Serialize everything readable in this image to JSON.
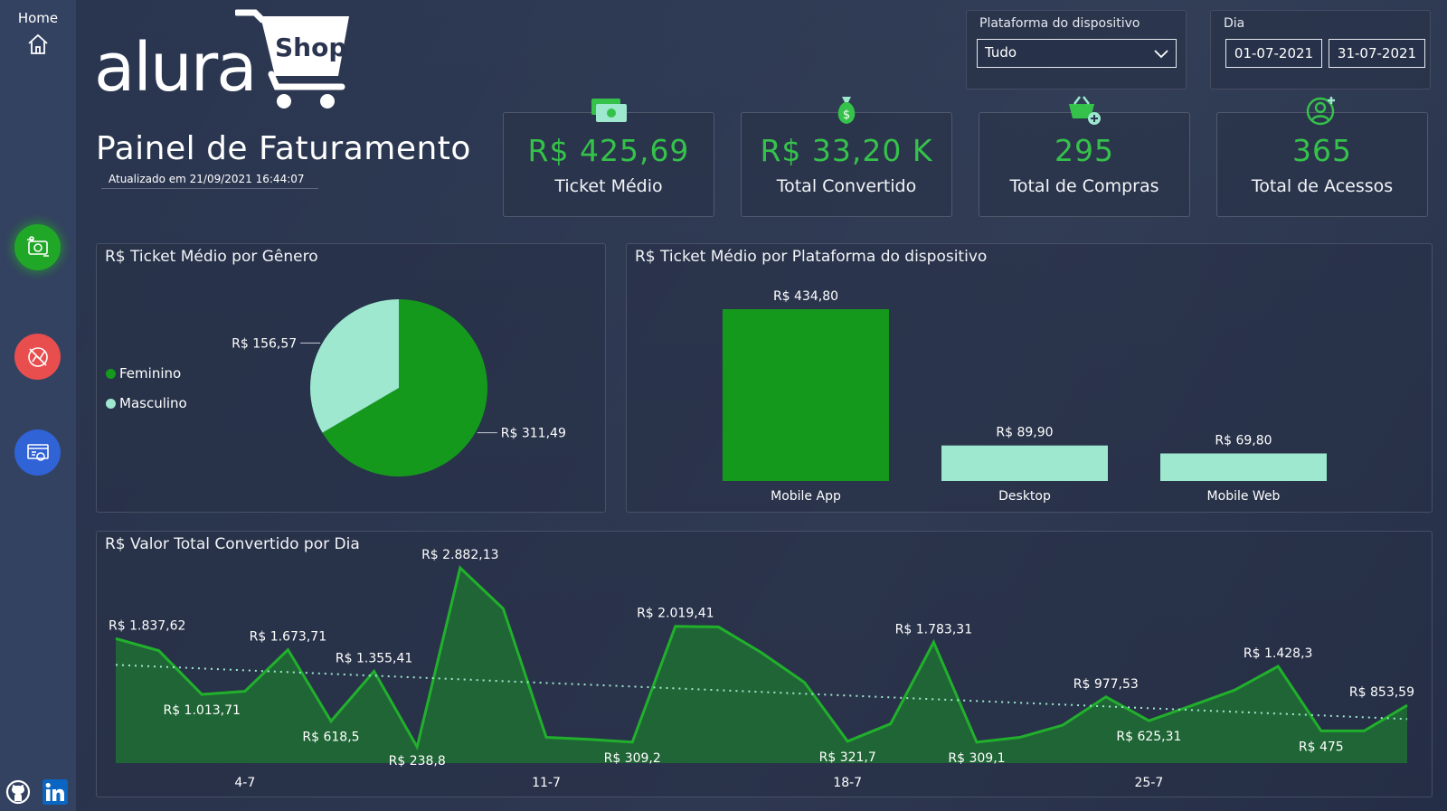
{
  "sidebar": {
    "home_label": "Home"
  },
  "header": {
    "logo_text": "alura",
    "logo_badge": "Shop",
    "title": "Painel de Faturamento",
    "updated": "Atualizado em 21/09/2021 16:44:07"
  },
  "filters": {
    "platform": {
      "label": "Plataforma do dispositivo",
      "value": "Tudo"
    },
    "day": {
      "label": "Dia",
      "start": "01-07-2021",
      "end": "31-07-2021"
    }
  },
  "kpis": [
    {
      "value": "R$ 425,69",
      "label": "Ticket Médio",
      "icon": "money-bills-icon"
    },
    {
      "value": "R$ 33,20 K",
      "label": "Total Convertido",
      "icon": "money-bag-icon"
    },
    {
      "value": "295",
      "label": "Total de Compras",
      "icon": "basket-add-icon"
    },
    {
      "value": "365",
      "label": "Total de Acessos",
      "icon": "user-add-icon"
    }
  ],
  "colors": {
    "accent_green": "#35c24a",
    "dark_green": "#15991d",
    "mint": "#9de8cf",
    "background": "#27324a"
  },
  "chart_data": [
    {
      "type": "pie",
      "title": "R$ Ticket Médio por Gênero",
      "legend": [
        "Feminino",
        "Masculino"
      ],
      "legend_position": "left",
      "series": [
        {
          "name": "Feminino",
          "value": 311.49,
          "label": "R$ 311,49",
          "color": "#15991d"
        },
        {
          "name": "Masculino",
          "value": 156.57,
          "label": "R$ 156,57",
          "color": "#9de8cf"
        }
      ]
    },
    {
      "type": "bar",
      "title": "R$ Ticket Médio por Plataforma do dispositivo",
      "categories": [
        "Mobile App",
        "Desktop",
        "Mobile Web"
      ],
      "values": [
        434.8,
        89.9,
        69.8
      ],
      "labels": [
        "R$ 434,80",
        "R$ 89,90",
        "R$ 69,80"
      ],
      "colors": [
        "#15991d",
        "#9de8cf",
        "#9de8cf"
      ],
      "ylim": [
        0,
        434.8
      ]
    },
    {
      "type": "area",
      "title": "R$ Valor Total Convertido por Dia",
      "x_ticks": [
        "4-7",
        "11-7",
        "18-7",
        "25-7"
      ],
      "x": [
        1,
        2,
        3,
        4,
        5,
        6,
        7,
        8,
        9,
        10,
        11,
        12,
        13,
        14,
        15,
        16,
        17,
        18,
        19,
        20,
        21,
        22,
        23,
        24,
        25,
        26,
        27,
        28,
        29,
        30,
        31
      ],
      "values": [
        1837.62,
        1660,
        1013.71,
        1060,
        1673.71,
        618.5,
        1355.41,
        238.8,
        2882.13,
        2280,
        380,
        350,
        309.2,
        2019.41,
        2010,
        1630,
        1190,
        321.7,
        580,
        1783.31,
        309.1,
        380,
        560,
        977.53,
        625.31,
        850,
        1080,
        1428.3,
        475,
        475,
        853.59
      ],
      "point_labels": [
        {
          "index": 0,
          "text": "R$ 1.837,62"
        },
        {
          "index": 2,
          "text": "R$ 1.013,71"
        },
        {
          "index": 4,
          "text": "R$ 1.673,71"
        },
        {
          "index": 5,
          "text": "R$ 618,5"
        },
        {
          "index": 6,
          "text": "R$ 1.355,41"
        },
        {
          "index": 7,
          "text": "R$ 238,8"
        },
        {
          "index": 8,
          "text": "R$ 2.882,13"
        },
        {
          "index": 12,
          "text": "R$ 309,2"
        },
        {
          "index": 13,
          "text": "R$ 2.019,41"
        },
        {
          "index": 17,
          "text": "R$ 321,7"
        },
        {
          "index": 19,
          "text": "R$ 1.783,31"
        },
        {
          "index": 20,
          "text": "R$ 309,1"
        },
        {
          "index": 23,
          "text": "R$ 977,53"
        },
        {
          "index": 24,
          "text": "R$ 625,31"
        },
        {
          "index": 27,
          "text": "R$ 1.428,3"
        },
        {
          "index": 28,
          "text": "R$ 475"
        },
        {
          "index": 30,
          "text": "R$ 853,59"
        }
      ],
      "trend": {
        "start": 1450,
        "end": 650,
        "style": "dotted"
      },
      "ylim": [
        0,
        2950
      ]
    }
  ]
}
